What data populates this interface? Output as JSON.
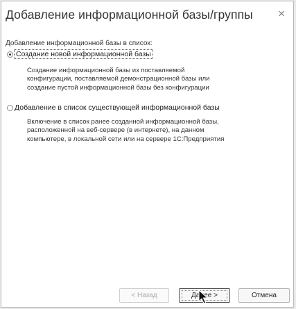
{
  "dialog": {
    "title": "Добавление информационной базы/группы",
    "close_glyph": "×"
  },
  "intro": "Добавление информационной базы в список:",
  "options": [
    {
      "label": "Создание новой информационной базы",
      "selected": true,
      "description": [
        "Создание информационной базы из поставляемой",
        "конфигурации, поставляемой демонстрационной базы или",
        "создание пустой информационной базы без конфигурации"
      ]
    },
    {
      "label": "Добавление в список существующей информационной базы",
      "selected": false,
      "description": [
        "Включение в список ранее созданной информационной базы,",
        "расположенной на веб-сервере (в интернете), на данном",
        "компьютере, в локальной сети или на сервере 1С:Предприятия"
      ]
    }
  ],
  "buttons": {
    "back": "< Назад",
    "next": "Далее >",
    "cancel": "Отмена"
  },
  "icons": {
    "close": "close-icon",
    "cursor": "mouse-pointer-icon"
  }
}
